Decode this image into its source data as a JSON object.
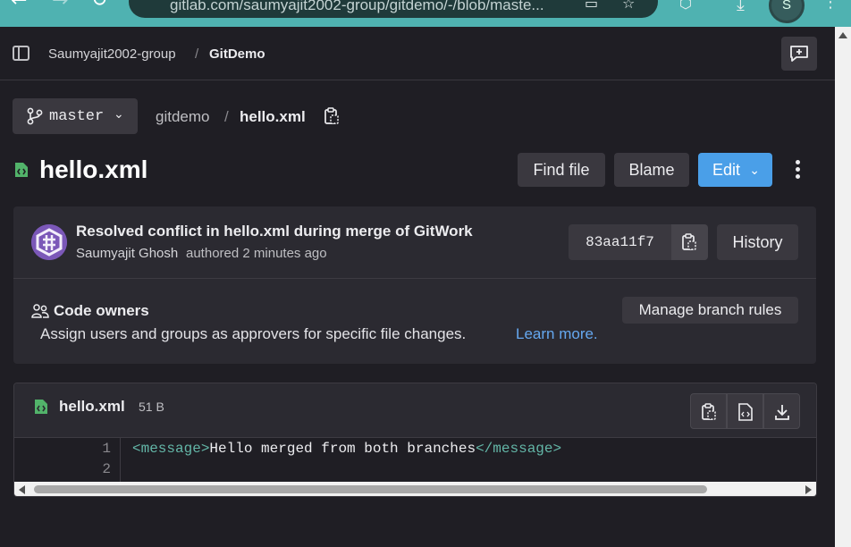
{
  "browser": {
    "url": "gitlab.com/saumyajit2002-group/gitdemo/-/blob/maste...",
    "profile_initial": "S",
    "back_glyph": "←",
    "forward_glyph": "→",
    "reload_glyph": "↻"
  },
  "header": {
    "group": "Saumyajit2002-group",
    "separator": "/",
    "project": "GitDemo"
  },
  "ref": {
    "branch": "master",
    "path_root": "gitdemo",
    "path_separator": "/",
    "file": "hello.xml"
  },
  "title": {
    "filename": "hello.xml",
    "find_file": "Find file",
    "blame": "Blame",
    "edit": "Edit"
  },
  "commit": {
    "message": "Resolved conflict in hello.xml during merge of GitWork",
    "author": "Saumyajit Ghosh",
    "meta": "authored 2 minutes ago",
    "sha": "83aa11f7",
    "history": "History"
  },
  "code_owners": {
    "title": "Code owners",
    "description": "Assign users and groups as approvers for specific file changes.",
    "link": "Learn more.",
    "manage_button": "Manage branch rules"
  },
  "file": {
    "name": "hello.xml",
    "size": "51 B",
    "lines": [
      {
        "number": "1",
        "open_tag": "<message>",
        "text": "Hello merged from both branches",
        "close_tag": "</message>"
      },
      {
        "number": "2",
        "open_tag": "",
        "text": "",
        "close_tag": ""
      }
    ]
  },
  "colors": {
    "background": "#1f1e24",
    "panel": "#2b2a31",
    "button": "#3a383f",
    "accent_blue": "#4a9fe8",
    "link": "#65a8f0",
    "file_icon_green": "#52b36a",
    "browser_teal": "#4fb2b1"
  }
}
